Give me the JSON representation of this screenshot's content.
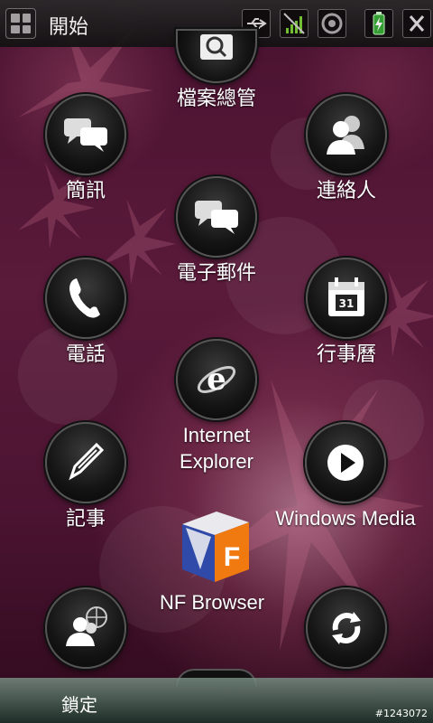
{
  "topbar": {
    "title": "開始",
    "icons": [
      "usb-icon",
      "signal-icon",
      "speaker-icon",
      "battery-icon",
      "close-icon"
    ]
  },
  "apps": [
    {
      "label": "檔案總管",
      "icon": "file-explorer-icon"
    },
    {
      "label": "簡訊",
      "icon": "messaging-icon"
    },
    {
      "label": "連絡人",
      "icon": "contacts-icon"
    },
    {
      "label": "電子郵件",
      "icon": "email-icon"
    },
    {
      "label": "電話",
      "icon": "phone-icon"
    },
    {
      "label": "行事曆",
      "icon": "calendar-icon",
      "calendar_day": "31"
    },
    {
      "label1": "Internet",
      "label2": "Explorer",
      "icon": "internet-explorer-icon"
    },
    {
      "label": "記事",
      "icon": "notes-icon"
    },
    {
      "label": "Windows Media",
      "icon": "media-play-icon"
    },
    {
      "label": "NF Browser",
      "icon": "nf-browser-icon",
      "icon_letter": "F"
    },
    {
      "label": "",
      "icon": "messenger-icon"
    },
    {
      "label": "",
      "icon": "sync-icon"
    }
  ],
  "bottombar": {
    "lock_label": "鎖定"
  },
  "watermark": "#1243072",
  "colors": {
    "background": "#4a1230",
    "icon_bg": "#141414",
    "text": "#ffffff"
  }
}
